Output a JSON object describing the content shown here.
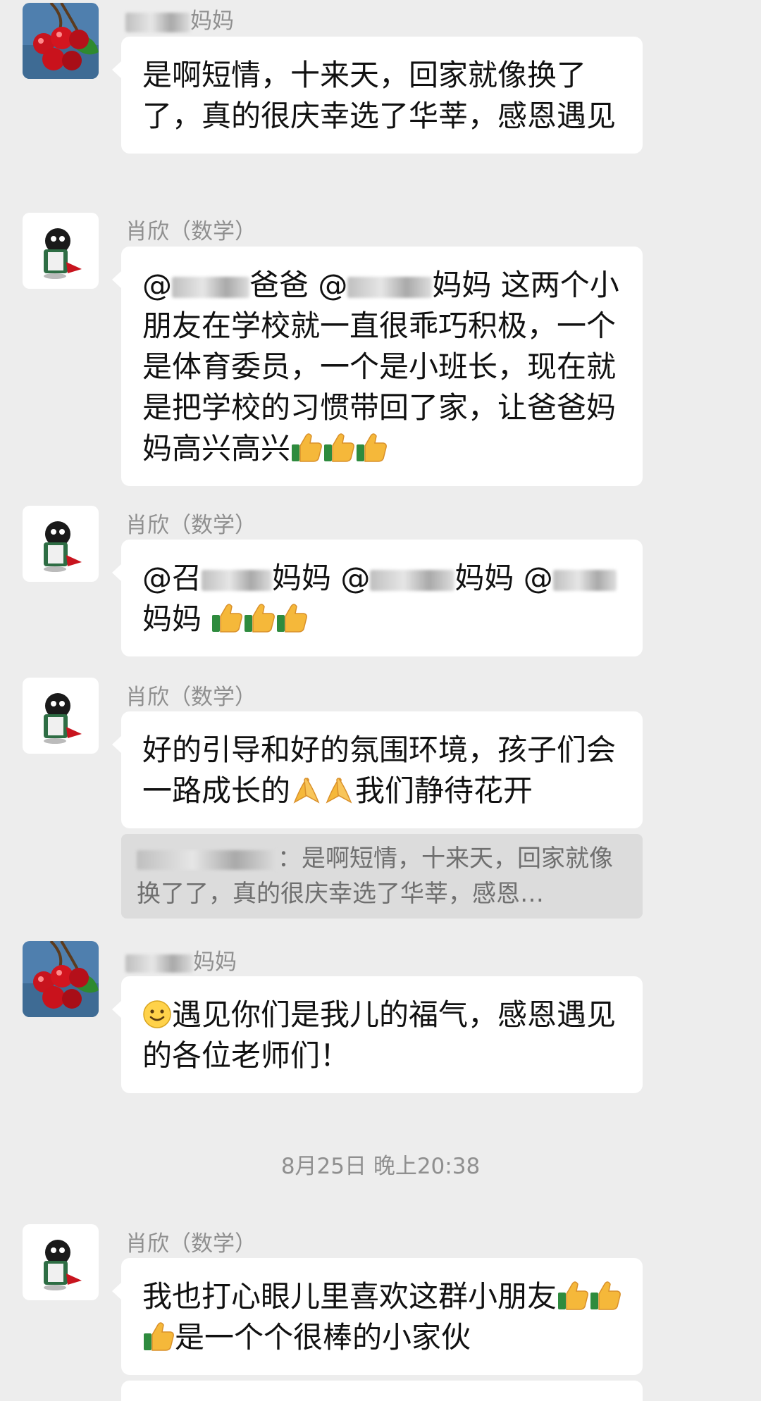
{
  "messages": [
    {
      "sender_visible": "妈妈",
      "text": "是啊短情，十来天，回家就像换了了，真的很庆幸选了华莘，感恩遇见"
    },
    {
      "sender": "肖欣（数学）",
      "mention_a_suffix": "爸爸",
      "mention_b_suffix": "妈妈",
      "line1_tail": "这两",
      "body": "个小朋友在学校就一直很乖巧积极，一个是体育委员，一个是小班长，现在就是把学校的习惯带回了家，让爸爸妈妈高兴高兴"
    },
    {
      "sender": "肖欣（数学）",
      "mention_1": "@召",
      "mention_1_suffix": "妈妈",
      "mention_2": "@",
      "mention_2_suffix": "妈妈",
      "mention_3": "@",
      "mention_3_suffix": "妈妈"
    },
    {
      "sender": "肖欣（数学）",
      "text_part1": "好的引导和好的氛围环境，孩子们会一路成长的",
      "text_part2": "我们静待花开",
      "quote_visible": "：是啊短情，十来天，回家就像换了了，真的很庆幸选了华莘，感恩…"
    },
    {
      "sender_visible": "妈妈",
      "text": "遇见你们是我儿的福气，感恩遇见的各位老师们！"
    }
  ],
  "timestamp": "8月25日 晚上20:38",
  "last_message": {
    "sender": "肖欣（数学）",
    "text_part1": "我也打心眼儿里喜欢这群小朋友",
    "text_part2": "是一个个很棒的小家伙"
  },
  "icons": [
    "cherry-avatar-icon",
    "penguin-avatar-icon",
    "thumbs-up-emoji-icon",
    "praying-hands-emoji-icon",
    "smile-emoji-icon"
  ]
}
